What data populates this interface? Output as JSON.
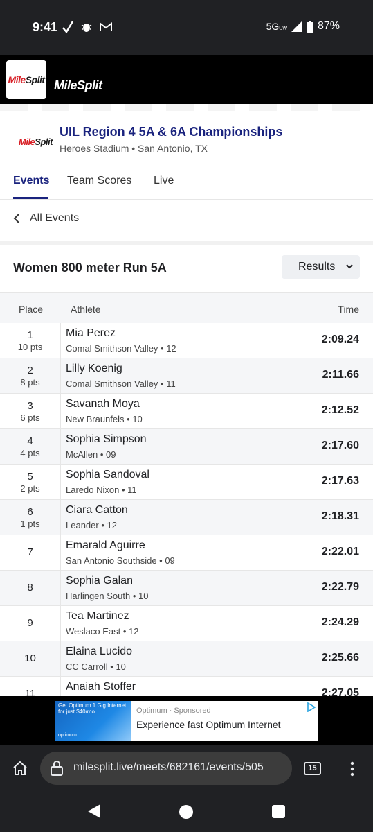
{
  "status_bar": {
    "time": "9:41",
    "network": "5G",
    "network_sub": "UW",
    "battery": "87%",
    "icons": [
      "check-icon",
      "bug-icon",
      "gmail-icon",
      "signal-icon",
      "battery-icon"
    ]
  },
  "site": {
    "logo_text_a": "Mile",
    "logo_text_b": "Split",
    "wordmark": "MileSplit"
  },
  "meet": {
    "title": "UIL Region 4 5A & 6A Championships",
    "location": "Heroes Stadium • San Antonio, TX"
  },
  "tabs": [
    {
      "label": "Events",
      "active": true
    },
    {
      "label": "Team Scores",
      "active": false
    },
    {
      "label": "Live",
      "active": false
    }
  ],
  "back_link": "All Events",
  "event": {
    "title": "Women 800 meter Run 5A",
    "view_select": "Results"
  },
  "table": {
    "headers": {
      "place": "Place",
      "athlete": "Athlete",
      "time": "Time"
    },
    "rows": [
      {
        "place": "1",
        "points": "10 pts",
        "name": "Mia Perez",
        "detail": "Comal Smithson Valley • 12",
        "time": "2:09.24"
      },
      {
        "place": "2",
        "points": "8 pts",
        "name": "Lilly Koenig",
        "detail": "Comal Smithson Valley • 11",
        "time": "2:11.66"
      },
      {
        "place": "3",
        "points": "6 pts",
        "name": "Savanah Moya",
        "detail": "New Braunfels • 10",
        "time": "2:12.52"
      },
      {
        "place": "4",
        "points": "4 pts",
        "name": "Sophia Simpson",
        "detail": "McAllen • 09",
        "time": "2:17.60"
      },
      {
        "place": "5",
        "points": "2 pts",
        "name": "Sophia Sandoval",
        "detail": "Laredo Nixon • 11",
        "time": "2:17.63"
      },
      {
        "place": "6",
        "points": "1 pts",
        "name": "Ciara Catton",
        "detail": "Leander • 12",
        "time": "2:18.31"
      },
      {
        "place": "7",
        "points": "",
        "name": "Emarald Aguirre",
        "detail": "San Antonio Southside • 09",
        "time": "2:22.01"
      },
      {
        "place": "8",
        "points": "",
        "name": "Sophia Galan",
        "detail": "Harlingen South • 10",
        "time": "2:22.79"
      },
      {
        "place": "9",
        "points": "",
        "name": "Tea Martinez",
        "detail": "Weslaco East • 12",
        "time": "2:24.29"
      },
      {
        "place": "10",
        "points": "",
        "name": "Elaina Lucido",
        "detail": "CC Carroll • 10",
        "time": "2:25.66"
      },
      {
        "place": "11",
        "points": "",
        "name": "Anaiah Stoffer",
        "detail": "",
        "time": "2:27.05"
      }
    ]
  },
  "ad": {
    "image_text": "Get Optimum 1 Gig Internet for just $40/mo.",
    "image_brand": "optimum.",
    "source": "Optimum",
    "sponsored": "· Sponsored",
    "headline": "Experience fast Optimum Internet"
  },
  "browser": {
    "url": "milesplit.live/meets/682161/events/505",
    "tab_count": "15"
  }
}
